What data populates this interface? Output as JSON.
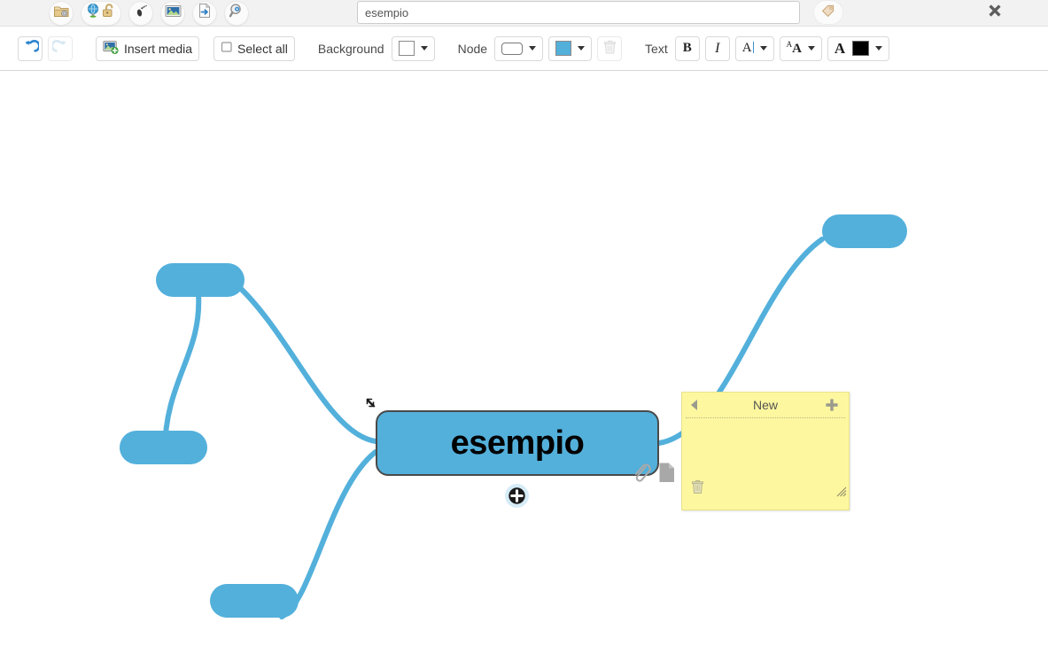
{
  "window": {
    "title": "esempio"
  },
  "topbar": {
    "buttons": [
      {
        "name": "project-settings-icon",
        "label": "Project settings"
      },
      {
        "name": "publish-share-icon",
        "label": "Publish / share"
      },
      {
        "name": "footprints-icon",
        "label": "History"
      },
      {
        "name": "image-icon",
        "label": "Image"
      },
      {
        "name": "export-document-icon",
        "label": "Export"
      },
      {
        "name": "search-preview-icon",
        "label": "Search"
      }
    ],
    "search": {
      "value": "esempio",
      "placeholder": ""
    },
    "tag_button_label": "Tags",
    "close_button_label": "Close"
  },
  "toolbar": {
    "undo_label": "Undo",
    "redo_label": "Redo",
    "insert_media_label": "Insert media",
    "select_all_label": "Select all",
    "background_label": "Background",
    "background_color": "#ffffff",
    "node_label": "Node",
    "node_shape_label": "Rounded rectangle",
    "node_color": "#53b0db",
    "delete_label": "Delete",
    "text_label": "Text",
    "bold_label": "B",
    "italic_label": "I",
    "font_size_label": "Font size",
    "font_family_label": "Font family",
    "text_color_label": "Text color",
    "text_color": "#000000"
  },
  "canvas": {
    "background": "#ffffff",
    "link_color": "#53b0db",
    "nodes": [
      {
        "id": "root",
        "text": "esempio",
        "color": "#53b0db",
        "border_color": "#4a4a4a"
      },
      {
        "id": "n-top-left",
        "text": "",
        "color": "#53b0db"
      },
      {
        "id": "n-mid-left",
        "text": "",
        "color": "#53b0db"
      },
      {
        "id": "n-bottom-left",
        "text": "",
        "color": "#53b0db"
      },
      {
        "id": "n-top-right",
        "text": "",
        "color": "#53b0db"
      }
    ],
    "root_tools": {
      "resize_label": "Resize node",
      "attachment_label": "Attachment",
      "note_label": "Note",
      "add_child_label": "Add child node"
    }
  },
  "sticky_note": {
    "title": "New",
    "body": "",
    "prev_label": "Previous note",
    "add_label": "Add note",
    "delete_label": "Delete note",
    "resize_label": "Resize note",
    "color": "#fdf79f"
  }
}
